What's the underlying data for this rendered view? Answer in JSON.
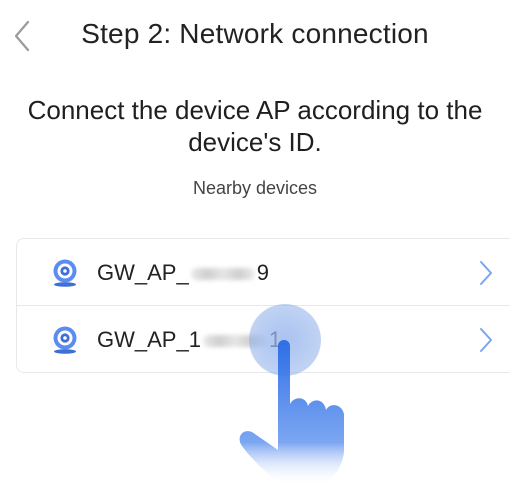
{
  "header": {
    "back_icon": "chevron-left-icon",
    "title": "Step 2: Network connection"
  },
  "instruction": "Connect the device AP according to the device's ID.",
  "nearby_label": "Nearby devices",
  "devices": [
    {
      "prefix": "GW_AP_",
      "suffix": "9",
      "icon": "camera-icon"
    },
    {
      "prefix": "GW_AP_1",
      "suffix": "1",
      "icon": "camera-icon"
    }
  ],
  "colors": {
    "accent": "#4a7fe0",
    "chevron": "#7aa4f0",
    "divider": "#e8e8e8",
    "text": "#222222"
  }
}
